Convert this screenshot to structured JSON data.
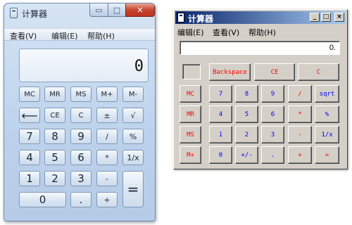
{
  "win7": {
    "title": "计算器",
    "controls": {
      "minimize": "▭",
      "maximize": "□",
      "close": "✕"
    },
    "menu": [
      {
        "label": "查看(V)"
      },
      {
        "label": "编辑(E)"
      },
      {
        "label": "帮助(H)"
      }
    ],
    "display": "0",
    "buttons": {
      "mc": "MC",
      "mr": "MR",
      "ms": "MS",
      "mplus": "M+",
      "mminus": "M-",
      "backspace": "⟵",
      "ce": "CE",
      "c": "C",
      "plusminus": "±",
      "sqrt": "√",
      "n7": "7",
      "n8": "8",
      "n9": "9",
      "divide": "/",
      "percent": "%",
      "n4": "4",
      "n5": "5",
      "n6": "6",
      "multiply": "*",
      "reciprocal": "1/x",
      "n1": "1",
      "n2": "2",
      "n3": "3",
      "minus": "-",
      "equals": "=",
      "n0": "0",
      "dot": ".",
      "plus": "+"
    }
  },
  "classic": {
    "title": "计算器",
    "controls": {
      "minimize": "_",
      "maximize": "□",
      "close": "×"
    },
    "menu": [
      {
        "label": "编辑(E)"
      },
      {
        "label": "查看(V)"
      },
      {
        "label": "帮助(H)"
      }
    ],
    "display": "0.",
    "buttons": {
      "backspace": "Backspace",
      "ce": "CE",
      "c": "C",
      "mc": "MC",
      "mr": "MR",
      "ms": "MS",
      "mplus": "M+",
      "n7": "7",
      "n8": "8",
      "n9": "9",
      "divide": "/",
      "sqrt": "sqrt",
      "n4": "4",
      "n5": "5",
      "n6": "6",
      "multiply": "*",
      "percent": "%",
      "n1": "1",
      "n2": "2",
      "n3": "3",
      "minus": "-",
      "reciprocal": "1/x",
      "n0": "0",
      "plusminus": "+/-",
      "dot": ".",
      "plus": "+",
      "equals": "="
    },
    "colors": {
      "red_keys": "#ff0000",
      "blue_keys": "#0000ff",
      "face": "#d4d0c8"
    }
  }
}
